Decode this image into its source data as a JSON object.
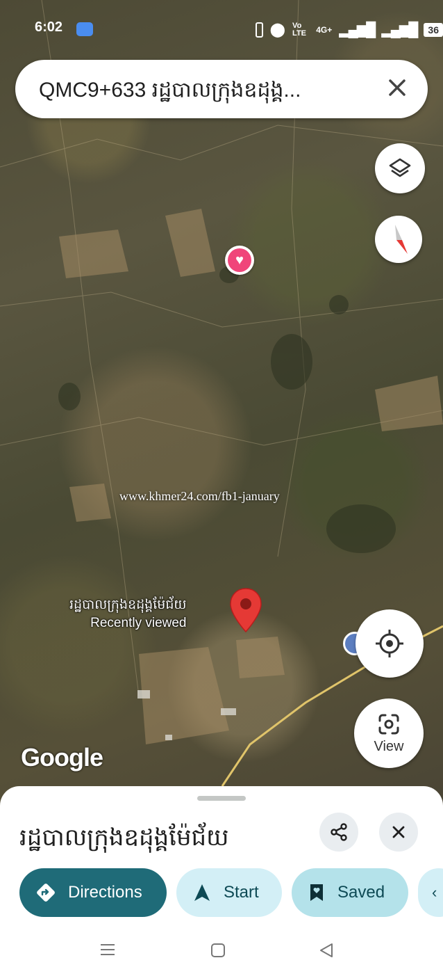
{
  "status_bar": {
    "time": "6:02",
    "network": "4G+",
    "volte": "Vo LTE",
    "battery": "36"
  },
  "search": {
    "query": "QMC9+633 រដ្ឋបាលក្រុងឧដុង្គ..."
  },
  "map": {
    "watermark": "www.khmer24.com/fb1-january",
    "pin_title": "រដ្ឋបាលក្រុងឧដុង្គម៉ែជ័យ",
    "pin_subtitle": "Recently viewed",
    "logo": "Google",
    "view_label": "View"
  },
  "place": {
    "title": "រដ្ឋបាលក្រុងឧដុង្គម៉ែជ័យ"
  },
  "actions": {
    "directions": "Directions",
    "start": "Start",
    "saved": "Saved"
  },
  "colors": {
    "directions_bg": "#1f6b78",
    "chip_bg": "#d3eff6",
    "saved_bg": "#b4e2ea",
    "pin_red": "#e53935",
    "heart_pink": "#f0457a"
  }
}
